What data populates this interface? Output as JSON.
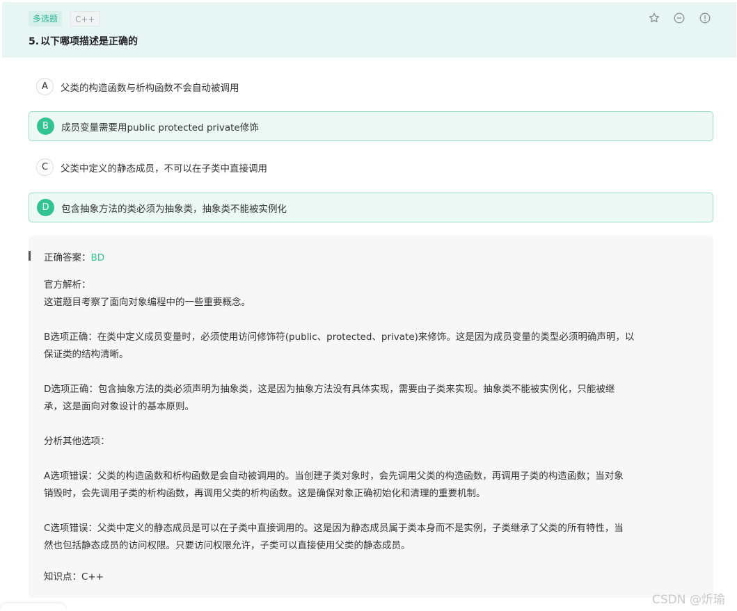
{
  "question": {
    "type_tag": "多选题",
    "lang_tag": "C++",
    "number": "5.",
    "title": "以下哪项描述是正确的"
  },
  "header_icons": [
    "star-icon",
    "minus-circle-icon",
    "info-circle-icon"
  ],
  "options": [
    {
      "letter": "A",
      "text": "父类的构造函数与析构函数不会自动被调用",
      "selected": false
    },
    {
      "letter": "B",
      "text": "成员变量需要用public protected private修饰",
      "selected": true
    },
    {
      "letter": "C",
      "text": "父类中定义的静态成员，不可以在子类中直接调用",
      "selected": false
    },
    {
      "letter": "D",
      "text": "包含抽象方法的类必须为抽象类，抽象类不能被实例化",
      "selected": true
    }
  ],
  "answer": {
    "label": "正确答案：",
    "value": "BD"
  },
  "explanation": {
    "heading": "官方解析：",
    "intro": "这道题目考察了面向对象编程中的一些重要概念。",
    "b_line1": "B选项正确：在类中定义成员变量时，必须使用访问修饰符(public、protected、private)来修饰。这是因为成员变量的类型必须明确声明，以",
    "b_line2": "保证类的结构清晰。",
    "d_line1": "D选项正确：包含抽象方法的类必须声明为抽象类，这是因为抽象方法没有具体实现，需要由子类来实现。抽象类不能被实例化，只能被继",
    "d_line2": "承，这是面向对象设计的基本原则。",
    "others": "分析其他选项：",
    "a_line1": "A选项错误：父类的构造函数和析构函数是会自动被调用的。当创建子类对象时，会先调用父类的构造函数，再调用子类的构造函数；当对象",
    "a_line2": "销毁时，会先调用子类的析构函数，再调用父类的析构函数。这是确保对象正确初始化和清理的重要机制。",
    "c_line1": "C选项错误：父类中定义的静态成员是可以在子类中直接调用的。这是因为静态成员属于类本身而不是实例，子类继承了父类的所有特性，当",
    "c_line2": "然也包括静态成员的访问权限。只要访问权限允许，子类可以直接使用父类的静态成员。"
  },
  "knowledge_point": "知识点：C++",
  "watermark": "CSDN @炘瑜",
  "colors": {
    "accent": "#33c392",
    "header_bg": "#e8f6f3",
    "selected_bg": "#edf9f5",
    "selected_border": "#9ddcc8",
    "answer_bg": "#f7f7f7"
  }
}
